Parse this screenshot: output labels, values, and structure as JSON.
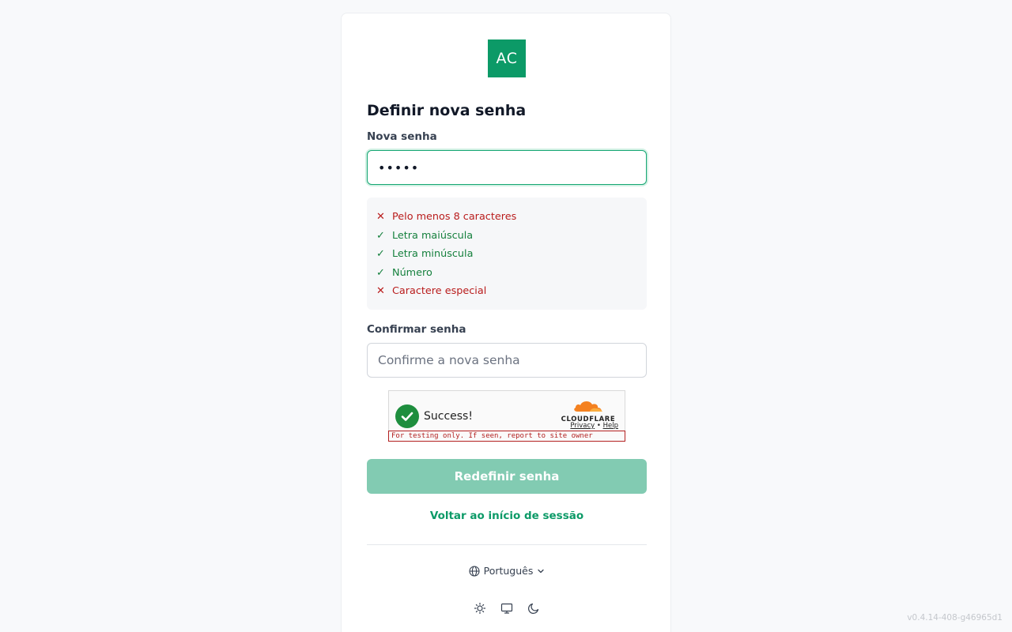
{
  "logo": {
    "text": "AC",
    "color": "#0c9a67"
  },
  "title": "Definir nova senha",
  "new_password": {
    "label": "Nova senha",
    "value_masked": "•••••"
  },
  "requirements": [
    {
      "text": "Pelo menos 8 caracteres",
      "met": false
    },
    {
      "text": "Letra maiúscula",
      "met": true
    },
    {
      "text": "Letra minúscula",
      "met": true
    },
    {
      "text": "Número",
      "met": true
    },
    {
      "text": "Caractere especial",
      "met": false
    }
  ],
  "confirm_password": {
    "label": "Confirmar senha",
    "placeholder": "Confirme a nova senha"
  },
  "turnstile": {
    "status": "Success!",
    "brand": "CLOUDFLARE",
    "privacy": "Privacy",
    "separator": " • ",
    "help": "Help",
    "note": "For testing only. If seen, report to site owner"
  },
  "submit_label": "Redefinir senha",
  "back_link": "Voltar ao início de sessão",
  "language": "Português",
  "theme_options": [
    "sun-icon",
    "monitor-icon",
    "moon-icon"
  ],
  "version": "v0.4.14-408-g46965d1",
  "colors": {
    "accent": "#0c9a67",
    "fail": "#b91c1c",
    "ok": "#15803d",
    "button_disabled": "#82cbb2"
  }
}
